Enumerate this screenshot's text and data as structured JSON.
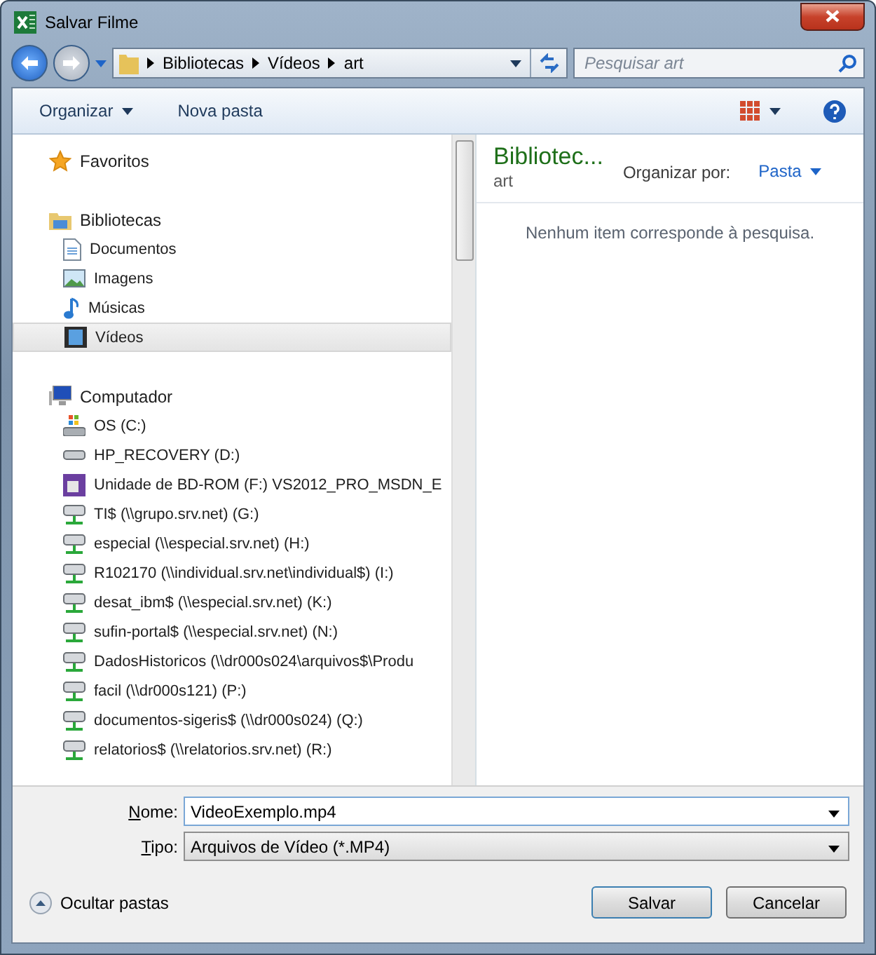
{
  "window": {
    "title": "Salvar Filme"
  },
  "address": {
    "crumbs": [
      "Bibliotecas",
      "Vídeos",
      "art"
    ],
    "search_placeholder": "Pesquisar art"
  },
  "toolbar": {
    "organize": "Organizar",
    "new_folder": "Nova pasta"
  },
  "nav": [
    {
      "label": "Favoritos",
      "kind": "star",
      "selected": false
    },
    {
      "label": "Bibliotecas",
      "kind": "library",
      "selected": false,
      "children": [
        {
          "label": "Documentos",
          "kind": "document",
          "selected": false
        },
        {
          "label": "Imagens",
          "kind": "image",
          "selected": false
        },
        {
          "label": "Músicas",
          "kind": "music",
          "selected": false
        },
        {
          "label": "Vídeos",
          "kind": "video",
          "selected": true
        }
      ]
    },
    {
      "label": "Computador",
      "kind": "computer",
      "selected": false,
      "children": [
        {
          "label": "OS (C:)",
          "kind": "os",
          "selected": false
        },
        {
          "label": "HP_RECOVERY (D:)",
          "kind": "drive",
          "selected": false
        },
        {
          "label": "Unidade de BD-ROM (F:) VS2012_PRO_MSDN_E",
          "kind": "disc",
          "selected": false
        },
        {
          "label": "TI$ (\\\\grupo.srv.net) (G:)",
          "kind": "network",
          "selected": false
        },
        {
          "label": "especial (\\\\especial.srv.net) (H:)",
          "kind": "network",
          "selected": false
        },
        {
          "label": "R102170 (\\\\individual.srv.net\\individual$) (I:)",
          "kind": "network",
          "selected": false
        },
        {
          "label": "desat_ibm$ (\\\\especial.srv.net) (K:)",
          "kind": "network",
          "selected": false
        },
        {
          "label": "sufin-portal$ (\\\\especial.srv.net) (N:)",
          "kind": "network",
          "selected": false
        },
        {
          "label": "DadosHistoricos (\\\\dr000s024\\arquivos$\\Produ",
          "kind": "network",
          "selected": false
        },
        {
          "label": "facil (\\\\dr000s121) (P:)",
          "kind": "network",
          "selected": false
        },
        {
          "label": "documentos-sigeris$ (\\\\dr000s024) (Q:)",
          "kind": "network",
          "selected": false
        },
        {
          "label": "relatorios$ (\\\\relatorios.srv.net) (R:)",
          "kind": "network",
          "selected": false
        }
      ]
    }
  ],
  "content": {
    "title": "Bibliotec...",
    "subtitle": "art",
    "arrange_label": "Organizar por:",
    "arrange_value": "Pasta",
    "empty_message": "Nenhum item corresponde à pesquisa."
  },
  "form": {
    "name_label": "Nome:",
    "name_value": "VideoExemplo.mp4",
    "type_label": "Tipo:",
    "type_value": "Arquivos de Vídeo (*.MP4)"
  },
  "footer": {
    "hide_folders": "Ocultar pastas",
    "save": "Salvar",
    "cancel": "Cancelar"
  }
}
